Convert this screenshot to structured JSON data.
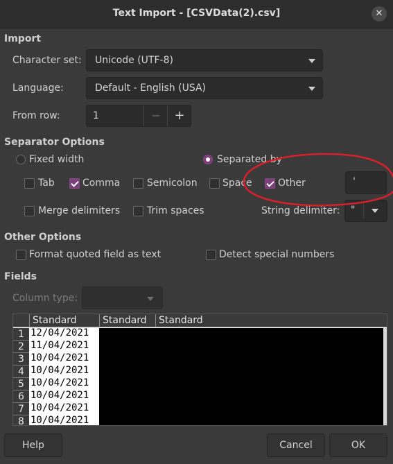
{
  "window": {
    "title": "Text Import - [CSVData(2).csv]"
  },
  "import": {
    "section": "Import",
    "charset_label": "Character set:",
    "charset_value": "Unicode (UTF-8)",
    "language_label": "Language:",
    "language_value": "Default - English (USA)",
    "fromrow_label": "From row:",
    "fromrow_value": "1",
    "minus": "−",
    "plus": "+"
  },
  "separator": {
    "section": "Separator Options",
    "fixed_width": "Fixed width",
    "separated_by": "Separated by",
    "tab": "Tab",
    "comma": "Comma",
    "semicolon": "Semicolon",
    "space": "Space",
    "other": "Other",
    "other_value": "'",
    "merge_delimiters": "Merge delimiters",
    "trim_spaces": "Trim spaces",
    "string_delimiter_label": "String delimiter:",
    "string_delimiter_value": "\""
  },
  "other_options": {
    "section": "Other Options",
    "format_quoted": "Format quoted field as text",
    "detect_special": "Detect special numbers"
  },
  "fields": {
    "section": "Fields",
    "column_type_label": "Column type:",
    "headers": [
      "Standard",
      "Standard",
      "Standard"
    ],
    "rows": [
      {
        "num": "1",
        "value": "12/04/2021"
      },
      {
        "num": "2",
        "value": "11/04/2021"
      },
      {
        "num": "3",
        "value": "10/04/2021"
      },
      {
        "num": "4",
        "value": "10/04/2021"
      },
      {
        "num": "5",
        "value": "10/04/2021"
      },
      {
        "num": "6",
        "value": "10/04/2021"
      },
      {
        "num": "7",
        "value": "10/04/2021"
      },
      {
        "num": "8",
        "value": "10/04/2021"
      }
    ]
  },
  "buttons": {
    "help": "Help",
    "cancel": "Cancel",
    "ok": "OK"
  },
  "icons": {
    "close": "close-icon",
    "dropdown": "chevron-down-icon",
    "check": "check-icon"
  },
  "colors": {
    "accent": "#7b3f7b",
    "annotation": "#d8202a",
    "background": "#3a3a3a"
  }
}
